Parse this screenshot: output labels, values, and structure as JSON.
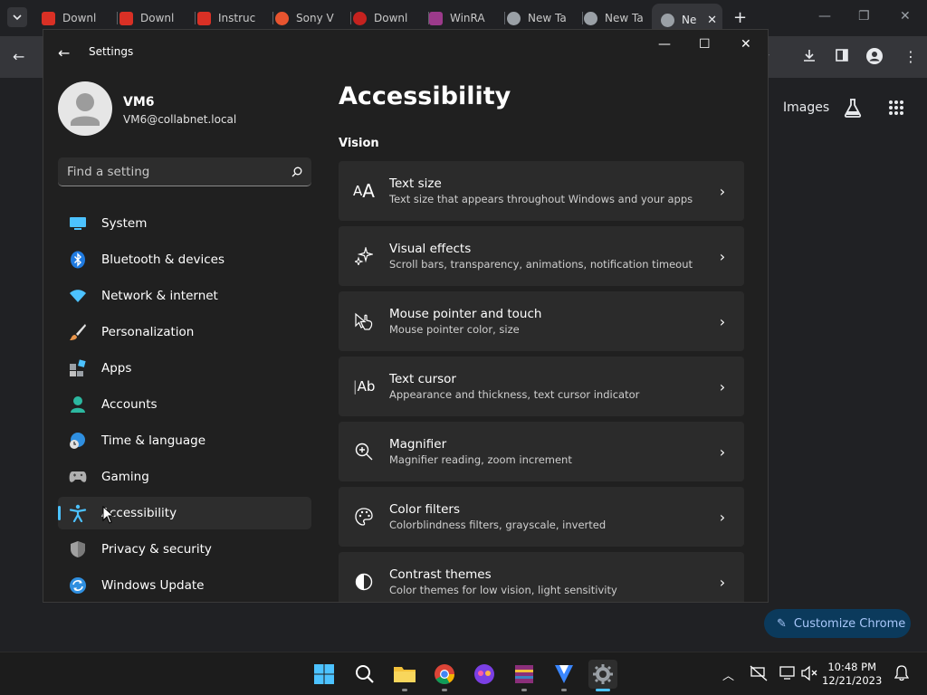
{
  "browser": {
    "tabs": [
      {
        "label": "Downl",
        "color": "#d93025"
      },
      {
        "label": "Downl",
        "color": "#d93025"
      },
      {
        "label": "Instruc",
        "color": "#d93025"
      },
      {
        "label": "Sony V",
        "color": "#e8542f"
      },
      {
        "label": "Downl",
        "color": "#c5221f"
      },
      {
        "label": "WinRA",
        "color": "#9c3a8b"
      },
      {
        "label": "New Ta",
        "color": "#9aa0a6"
      },
      {
        "label": "New Ta",
        "color": "#9aa0a6"
      },
      {
        "label": "Ne",
        "color": "#9aa0a6"
      }
    ],
    "new_tab": "+",
    "ntp_images_link": "Images",
    "customize_button": "Customize Chrome"
  },
  "settings": {
    "app_title": "Settings",
    "profile": {
      "name": "VM6",
      "email": "VM6@collabnet.local"
    },
    "search_placeholder": "Find a setting",
    "nav": [
      {
        "label": "System",
        "icon": "system-icon"
      },
      {
        "label": "Bluetooth & devices",
        "icon": "bluetooth-icon"
      },
      {
        "label": "Network & internet",
        "icon": "wifi-icon"
      },
      {
        "label": "Personalization",
        "icon": "brush-icon"
      },
      {
        "label": "Apps",
        "icon": "apps-icon"
      },
      {
        "label": "Accounts",
        "icon": "accounts-icon"
      },
      {
        "label": "Time & language",
        "icon": "globe-clock-icon"
      },
      {
        "label": "Gaming",
        "icon": "gamepad-icon"
      },
      {
        "label": "Accessibility",
        "icon": "accessibility-icon",
        "selected": true
      },
      {
        "label": "Privacy & security",
        "icon": "shield-icon"
      },
      {
        "label": "Windows Update",
        "icon": "update-icon"
      }
    ],
    "page_title": "Accessibility",
    "section": "Vision",
    "cards": [
      {
        "title": "Text size",
        "desc": "Text size that appears throughout Windows and your apps",
        "icon": "text-size-icon"
      },
      {
        "title": "Visual effects",
        "desc": "Scroll bars, transparency, animations, notification timeout",
        "icon": "sparkle-icon"
      },
      {
        "title": "Mouse pointer and touch",
        "desc": "Mouse pointer color, size",
        "icon": "pointer-touch-icon"
      },
      {
        "title": "Text cursor",
        "desc": "Appearance and thickness, text cursor indicator",
        "icon": "text-cursor-icon"
      },
      {
        "title": "Magnifier",
        "desc": "Magnifier reading, zoom increment",
        "icon": "magnifier-icon"
      },
      {
        "title": "Color filters",
        "desc": "Colorblindness filters, grayscale, inverted",
        "icon": "palette-icon"
      },
      {
        "title": "Contrast themes",
        "desc": "Color themes for low vision, light sensitivity",
        "icon": "contrast-icon"
      }
    ]
  },
  "taskbar": {
    "time": "10:48 PM",
    "date": "12/21/2023"
  },
  "colors": {
    "accent": "#4cc2ff",
    "card_bg": "#2b2b2b",
    "window_bg": "#202020"
  }
}
